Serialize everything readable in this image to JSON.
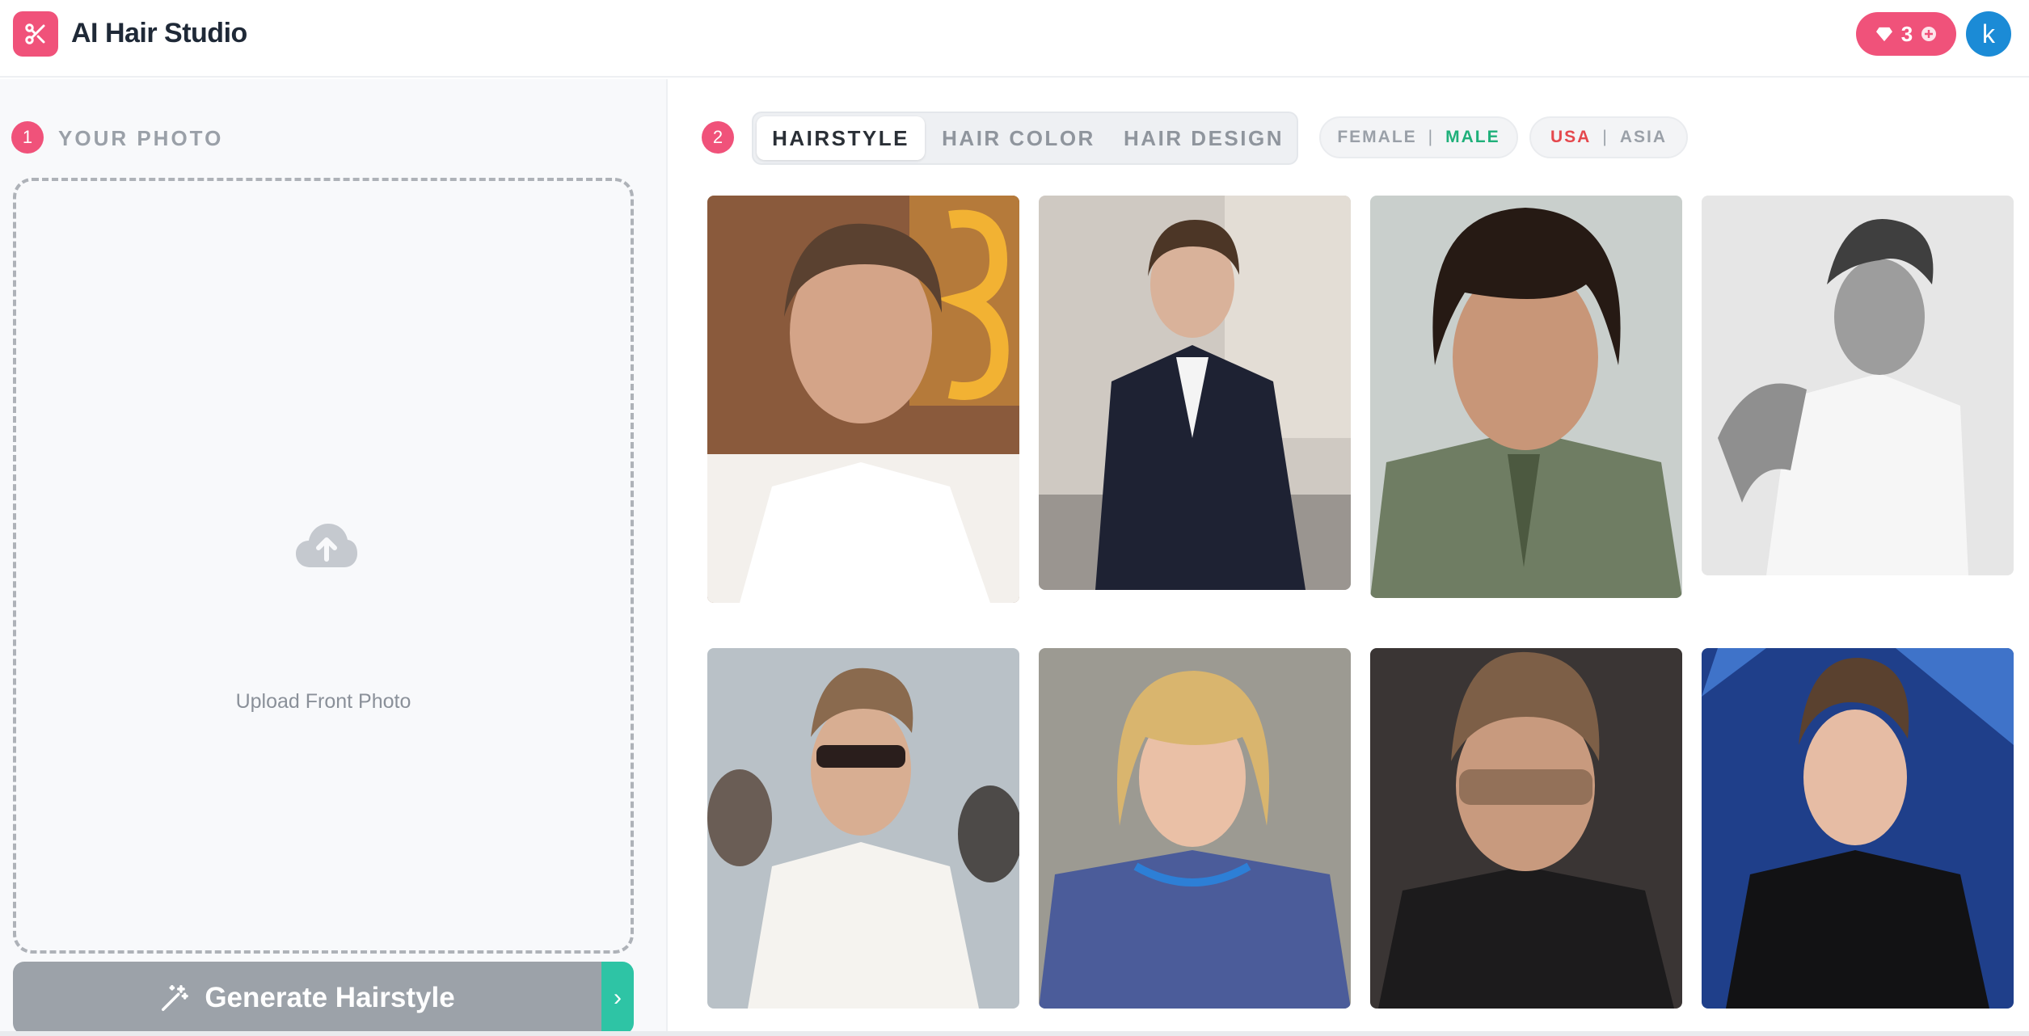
{
  "app": {
    "title": "AI Hair Studio",
    "brand_color": "#f0527a",
    "credits": "3",
    "avatar_letter": "k"
  },
  "step1": {
    "number": "1",
    "label": "YOUR PHOTO",
    "upload_text": "Upload Front Photo",
    "generate_label": "Generate Hairstyle",
    "arrow_glyph": "›"
  },
  "step2": {
    "number": "2",
    "tabs": [
      {
        "label": "HAIRSTYLE",
        "active": true
      },
      {
        "label": "HAIR COLOR",
        "active": false
      },
      {
        "label": "HAIR DESIGN",
        "active": false
      }
    ],
    "gender": {
      "female": "FEMALE",
      "male": "MALE",
      "selected": "MALE",
      "separator": "|"
    },
    "region": {
      "usa": "USA",
      "asia": "ASIA",
      "selected": "USA",
      "separator": "|"
    }
  },
  "gallery": [
    {
      "description": "man with tousled hair, white shirt, gold backdrop"
    },
    {
      "description": "man in dark suit seated on sofa"
    },
    {
      "description": "man with curly dark hair and mustache, olive suit"
    },
    {
      "description": "black and white photo, curly hair, white tank top"
    },
    {
      "description": "man in sunglasses with quiff, white shirt"
    },
    {
      "description": "young man with shaggy blonde hair, blue sweater"
    },
    {
      "description": "man with textured hair, tinted sunglasses"
    },
    {
      "description": "man with swept-back hair, black suit, blue backdrop"
    }
  ],
  "colors": {
    "accent": "#f0527a",
    "avatar": "#1b8bd6",
    "generate_disabled": "#9ca2a9",
    "generate_arrow": "#2ec4a5",
    "male_selected": "#1fb07a",
    "usa_selected": "#e5484d"
  },
  "icons": {
    "logo": "scissors-icon",
    "credits": "gem-icon",
    "credits_add": "plus-circle-icon",
    "upload": "cloud-upload-icon",
    "generate": "magic-wand-icon",
    "arrow": "chevron-right-icon"
  }
}
